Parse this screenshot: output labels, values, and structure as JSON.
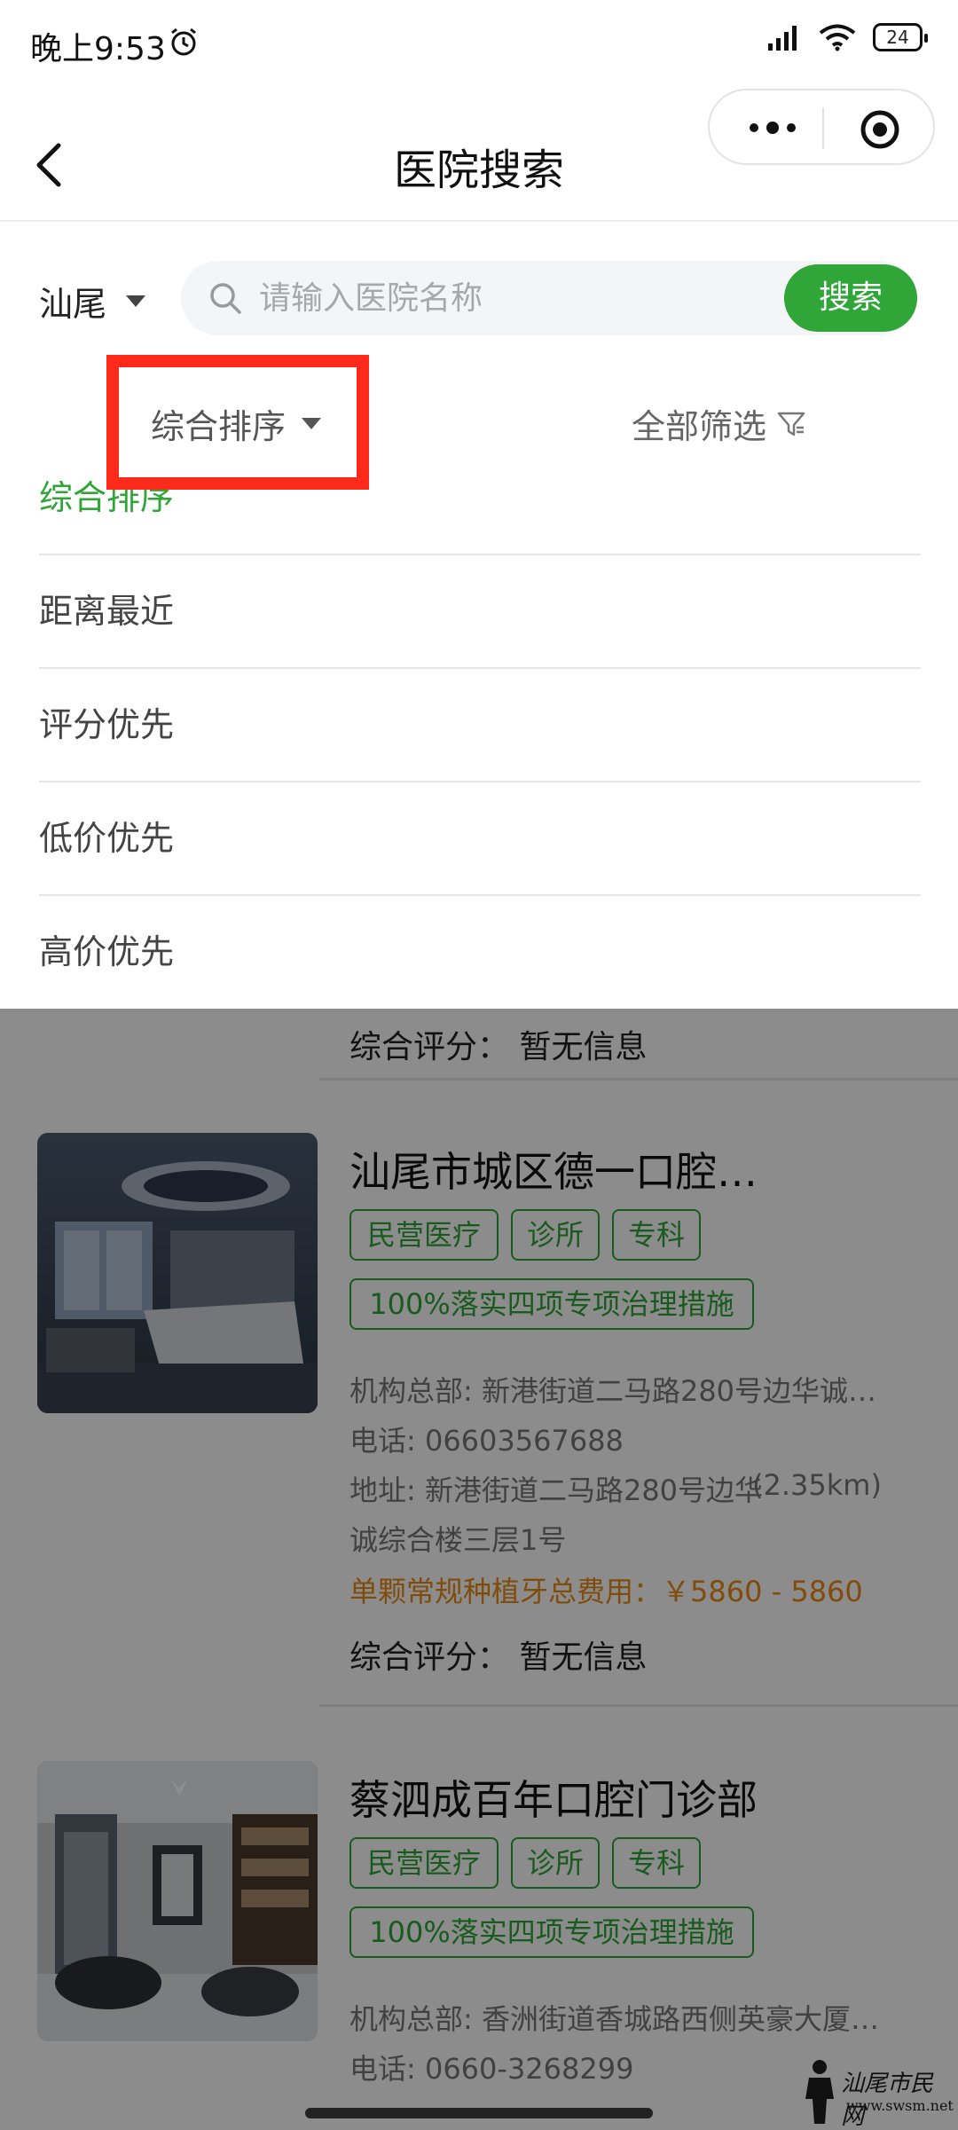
{
  "status_bar": {
    "time": "晚上9:53",
    "battery": "24"
  },
  "nav": {
    "title": "医院搜索"
  },
  "search": {
    "city": "汕尾",
    "placeholder": "请输入医院名称",
    "button_label": "搜索"
  },
  "filter_bar": {
    "sort_label": "综合排序",
    "filter_label": "全部筛选"
  },
  "sort_options": [
    "综合排序",
    "距离最近",
    "评分优先",
    "低价优先",
    "高价优先"
  ],
  "sort_selected_index": 0,
  "list": {
    "partial_rating": "综合评分：  暂无信息",
    "cards": [
      {
        "name": "汕尾市城区德一口腔…",
        "tags": [
          "民营医疗",
          "诊所",
          "专科"
        ],
        "policy_tag": "100%落实四项专项治理措施",
        "hq": "机构总部: 新港街道二马路280号边华诚…",
        "phone": "电话: 06603567688",
        "address_line1": "地址: 新港街道二马路280号边华",
        "distance": "(2.35km)",
        "address_line2": "诚综合楼三层1号",
        "price": "单颗常规种植牙总费用：￥5860 - 5860",
        "rating": "综合评分：  暂无信息"
      },
      {
        "name": "蔡泗成百年口腔门诊部",
        "tags": [
          "民营医疗",
          "诊所",
          "专科"
        ],
        "policy_tag": "100%落实四项专项治理措施",
        "hq": "机构总部: 香洲街道香城路西侧英豪大厦…",
        "phone": "电话: 0660-3268299"
      }
    ]
  },
  "watermark": {
    "text": "汕尾市民网",
    "url": "www.swsm.net"
  },
  "colors": {
    "accent_green": "#2fa637",
    "highlight_red": "#ff2a1a",
    "price_orange": "#e98b14"
  }
}
